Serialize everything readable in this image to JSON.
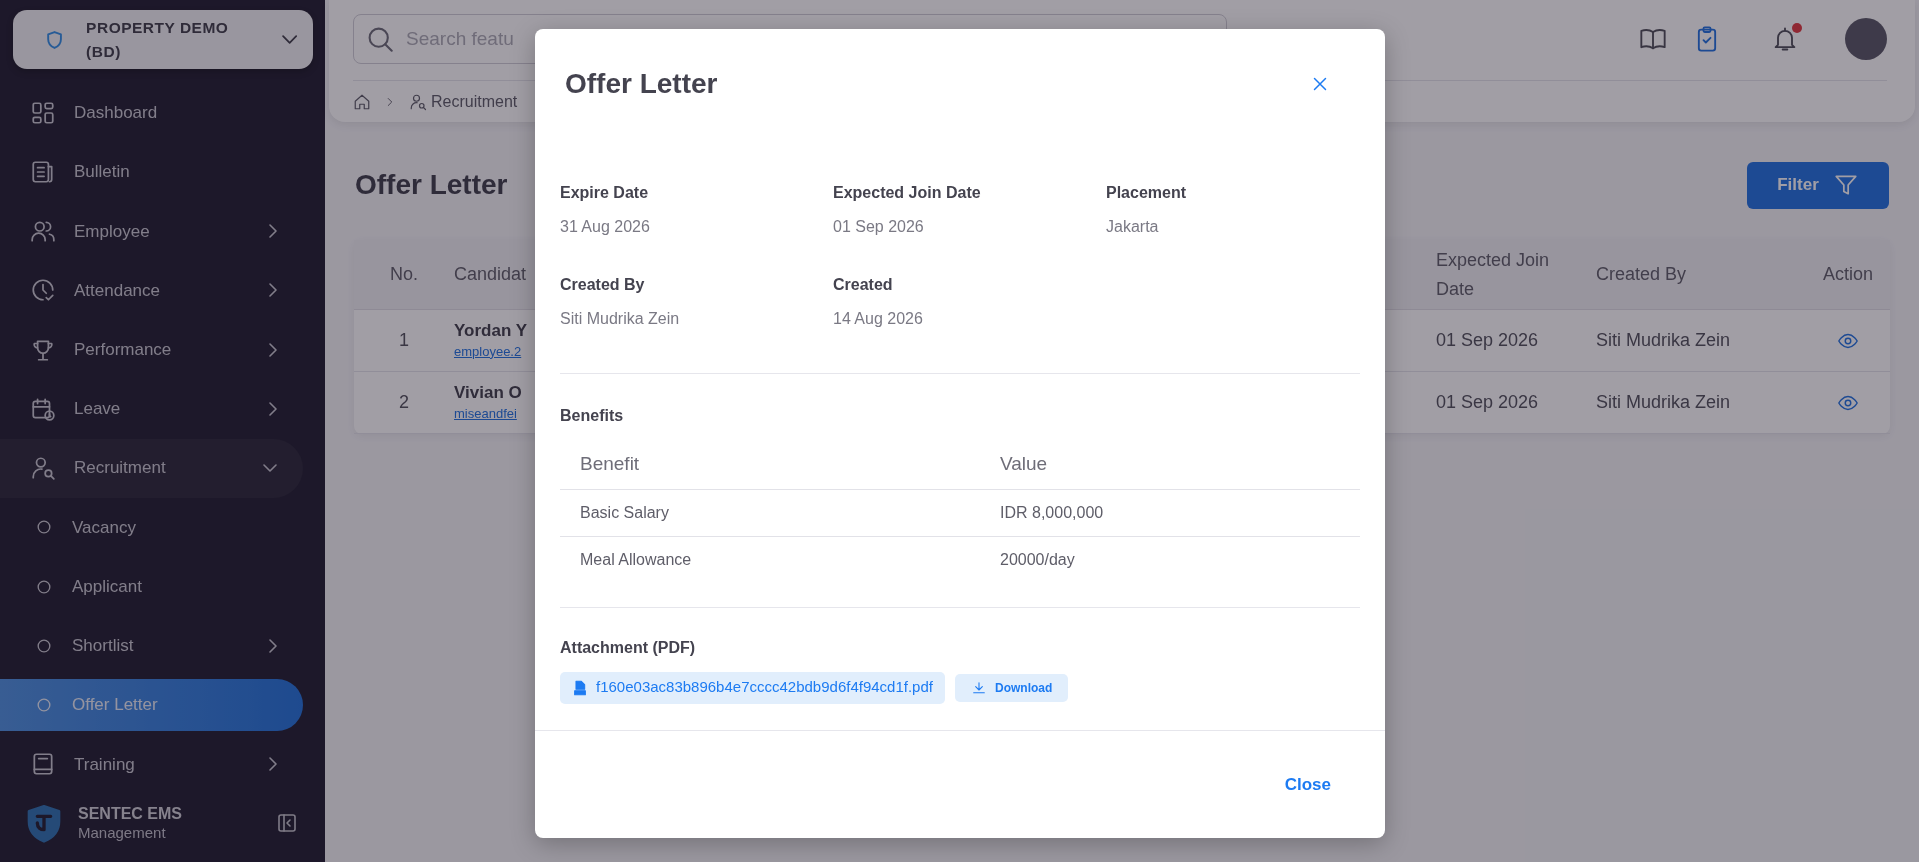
{
  "sidebar": {
    "company": "PROPERTY DEMO (BD)",
    "items": [
      {
        "label": "Dashboard",
        "selected": false
      },
      {
        "label": "Bulletin",
        "selected": false
      },
      {
        "label": "Employee",
        "selected": false,
        "expanded": false
      },
      {
        "label": "Attendance",
        "selected": false,
        "expanded": false
      },
      {
        "label": "Performance",
        "selected": false,
        "expanded": false
      },
      {
        "label": "Leave",
        "selected": false,
        "expanded": false
      },
      {
        "label": "Recruitment",
        "selected": false,
        "expanded": true,
        "children": [
          {
            "label": "Vacancy",
            "selected": false
          },
          {
            "label": "Applicant",
            "selected": false
          },
          {
            "label": "Shortlist",
            "selected": false,
            "expanded": false
          },
          {
            "label": "Offer Letter",
            "selected": true
          }
        ]
      },
      {
        "label": "Training",
        "selected": false,
        "expanded": false
      }
    ],
    "footer": {
      "brand": "SENTEC EMS",
      "subtitle": "Management"
    }
  },
  "header": {
    "search": {
      "placeholder": "Search featu"
    },
    "notification_dot": true
  },
  "breadcrumb": [
    "Recruitment"
  ],
  "page": {
    "title": "Offer Letter",
    "filter_button": "Filter"
  },
  "table": {
    "columns": [
      "No.",
      "Candidat",
      "Expected Join Date",
      "Created By",
      "Action"
    ],
    "rows": [
      {
        "no": "1",
        "name": "Yordan Y",
        "email": "employee.2",
        "join_date": "01 Sep 2026",
        "created_by": "Siti Mudrika Zein"
      },
      {
        "no": "2",
        "name": "Vivian O",
        "email": "miseandfei",
        "join_date": "01 Sep 2026",
        "created_by": "Siti Mudrika Zein"
      }
    ]
  },
  "modal": {
    "title": "Offer Letter",
    "details": [
      {
        "label": "Expire Date",
        "value": "31 Aug 2026"
      },
      {
        "label": "Expected Join Date",
        "value": "01 Sep 2026"
      },
      {
        "label": "Placement",
        "value": "Jakarta"
      },
      {
        "label": "Created By",
        "value": "Siti Mudrika Zein"
      },
      {
        "label": "Created",
        "value": "14 Aug 2026"
      }
    ],
    "benefits": {
      "title": "Benefits",
      "columns": [
        "Benefit",
        "Value"
      ],
      "rows": [
        [
          "Basic Salary",
          "IDR 8,000,000"
        ],
        [
          "Meal Allowance",
          "20000/day"
        ]
      ]
    },
    "attachment": {
      "label": "Attachment (PDF)",
      "file": "f160e03ac83b896b4e7cccc42bdb9d6f4f94cd1f.pdf",
      "download": "Download"
    },
    "close_button": "Close"
  }
}
